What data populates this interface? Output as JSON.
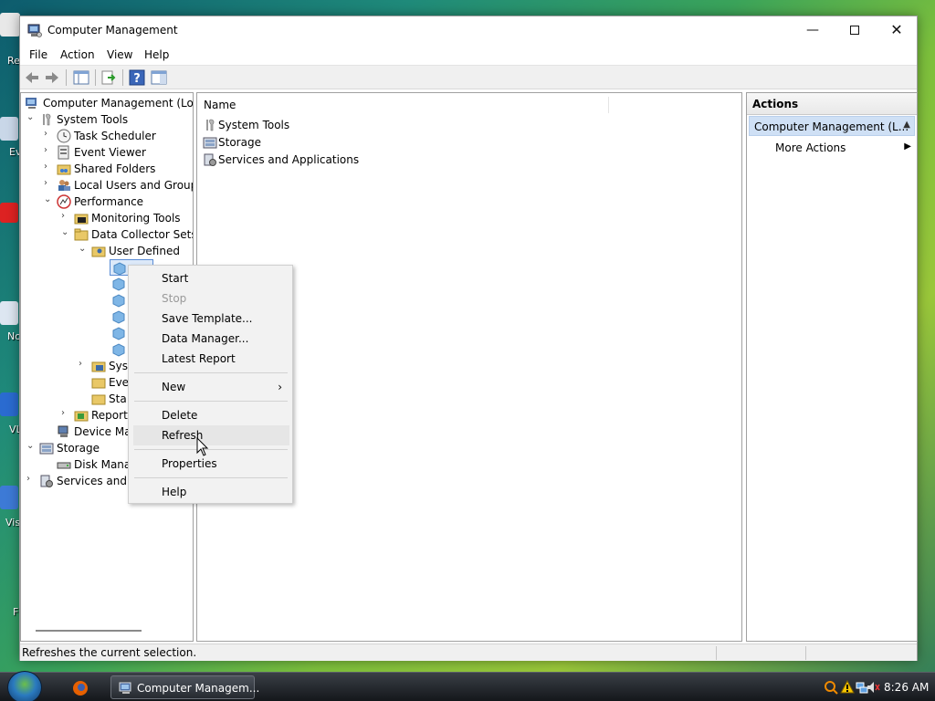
{
  "window": {
    "title": "Computer Management"
  },
  "menubar": {
    "items": [
      "File",
      "Action",
      "View",
      "Help"
    ]
  },
  "tree": {
    "items": [
      {
        "label": "Computer Management (Local"
      },
      {
        "label": "System Tools"
      },
      {
        "label": "Task Scheduler"
      },
      {
        "label": "Event Viewer"
      },
      {
        "label": "Shared Folders"
      },
      {
        "label": "Local Users and Groups"
      },
      {
        "label": "Performance"
      },
      {
        "label": "Monitoring Tools"
      },
      {
        "label": "Data Collector Sets"
      },
      {
        "label": "User Defined"
      },
      {
        "label": "Sys"
      },
      {
        "label": "Eve"
      },
      {
        "label": "Sta"
      },
      {
        "label": "Report"
      },
      {
        "label": "Device Ma"
      },
      {
        "label": "Storage"
      },
      {
        "label": "Disk Mana"
      },
      {
        "label": "Services and A"
      }
    ]
  },
  "center": {
    "column_name": "Name",
    "items": [
      {
        "label": "System Tools"
      },
      {
        "label": "Storage"
      },
      {
        "label": "Services and Applications"
      }
    ]
  },
  "actions": {
    "title": "Actions",
    "section": "Computer Management (L...",
    "more": "More Actions"
  },
  "context_menu": {
    "items": [
      {
        "label": "Start"
      },
      {
        "label": "Stop"
      },
      {
        "label": "Save Template..."
      },
      {
        "label": "Data Manager..."
      },
      {
        "label": "Latest Report"
      },
      {
        "label": "New"
      },
      {
        "label": "Delete"
      },
      {
        "label": "Refresh"
      },
      {
        "label": "Properties"
      },
      {
        "label": "Help"
      }
    ]
  },
  "status": {
    "text": "Refreshes the current selection."
  },
  "taskbar": {
    "task_label": "Computer Managem...",
    "clock": "8:26 AM"
  },
  "desktop": {
    "labels": [
      "Re",
      "Ev",
      "No",
      "VL",
      "Vis",
      "F"
    ]
  }
}
